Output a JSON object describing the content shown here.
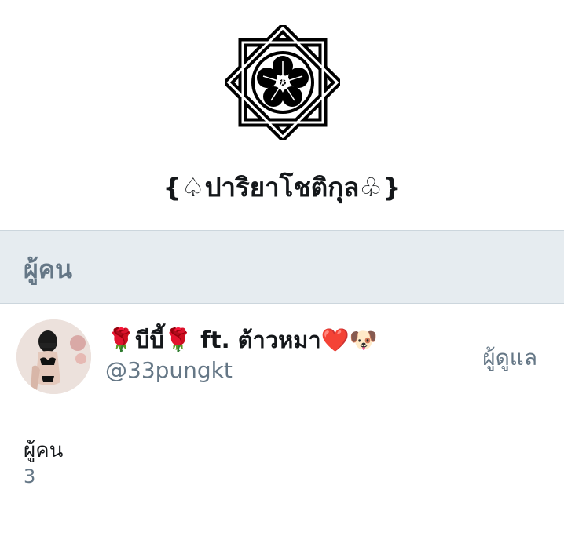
{
  "group": {
    "title": "{♤ปาริยาโชติกุล♧}",
    "logo_icon": "mon-crest-icon"
  },
  "section": {
    "title": "ผู้คน"
  },
  "members": [
    {
      "display_name": "🌹บีบี้🌹 ft. ต้าวหมา❤️🐶",
      "handle": "@33pungkt",
      "role": "ผู้ดูแล"
    }
  ],
  "stats": {
    "label": "ผู้คน",
    "count": "3"
  },
  "colors": {
    "primary_text": "#14171a",
    "secondary_text": "#657786",
    "section_bg": "#e6ecf0",
    "divider": "#ccd6dd"
  }
}
